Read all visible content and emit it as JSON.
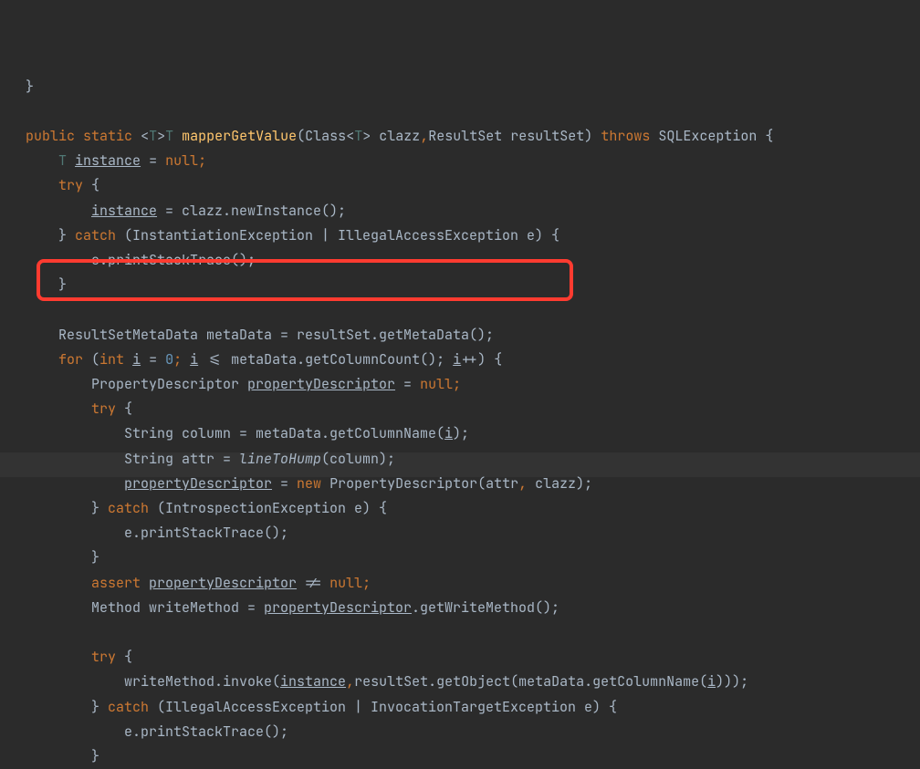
{
  "code": {
    "l0": "}",
    "l2_public": "public",
    "l2_static": "static",
    "l2_lt1": "<",
    "l2_T1": "T",
    "l2_gt1": ">",
    "l2_T2": "T",
    "l2_fn": "mapperGetValue",
    "l2_lp": "(",
    "l2_Class": "Class",
    "l2_lt2": "<",
    "l2_T3": "T",
    "l2_gt2": ">",
    "l2_clazz": " clazz",
    "l2_comma": ",",
    "l2_RS": "ResultSet",
    "l2_rs": " resultSet)",
    "l2_throws": "throws",
    "l2_SQL": "SQLException",
    "l2_ob": "{",
    "l3_T": "T",
    "l3_inst": "instance",
    "l3_eq": " = ",
    "l3_null": "null",
    "l3_semi": ";",
    "l4_try": "try",
    "l4_ob": " {",
    "l5_inst": "instance",
    "l5_eq": " = clazz.newInstance();",
    "l6_cb": "} ",
    "l6_catch": "catch",
    "l6_args": " (InstantiationException | IllegalAccessException e) {",
    "l7": "e.printStackTrace();",
    "l8": "}",
    "l10_pre": "ResultSetMetaData metaData = resultSet.getMetaData();",
    "l11_for": "for",
    "l11_lp": " (",
    "l11_int": "int",
    "l11_sp1": " ",
    "l11_i1": "i",
    "l11_eq": " = ",
    "l11_zero": "0",
    "l11_semi1": "; ",
    "l11_i2": "i",
    "l11_le": " <= metaData.getColumnCount(); ",
    "l11_i3": "i",
    "l11_pp": "++) {",
    "l12_pre": "PropertyDescriptor ",
    "l12_pd": "propertyDescriptor",
    "l12_eq": " = ",
    "l12_null": "null",
    "l12_semi": ";",
    "l13_try": "try",
    "l13_ob": " {",
    "l14_pre": "String column = metaData.getColumnName(",
    "l14_i": "i",
    "l14_post": ");",
    "l15_pre": "String attr = ",
    "l15_fn": "lineToHump",
    "l15_post": "(column);",
    "l16_pd": "propertyDescriptor",
    "l16_eq": " = ",
    "l16_new": "new",
    "l16_post": " PropertyDescriptor(attr",
    "l16_c": ",",
    "l16_clazz": " clazz);",
    "l17_cb": "} ",
    "l17_catch": "catch",
    "l17_args": " (IntrospectionException e) {",
    "l18": "e.printStackTrace();",
    "l19": "}",
    "l20_assert": "assert",
    "l20_sp": " ",
    "l20_pd": "propertyDescriptor",
    "l20_ne": " != ",
    "l20_null": "null",
    "l20_semi": ";",
    "l21_pre": "Method writeMethod = ",
    "l21_pd": "propertyDescriptor",
    "l21_post": ".getWriteMethod();",
    "l23_try": "try",
    "l23_ob": " {",
    "l24_pre": "writeMethod.invoke(",
    "l24_inst": "instance",
    "l24_c": ",",
    "l24_mid": "resultSet.getObject(metaData.getColumnName(",
    "l24_i": "i",
    "l24_post": ")));",
    "l25_cb": "} ",
    "l25_catch": "catch",
    "l25_args": " (IllegalAccessException | InvocationTargetException e) {",
    "l26": "e.printStackTrace();",
    "l27": "}"
  }
}
